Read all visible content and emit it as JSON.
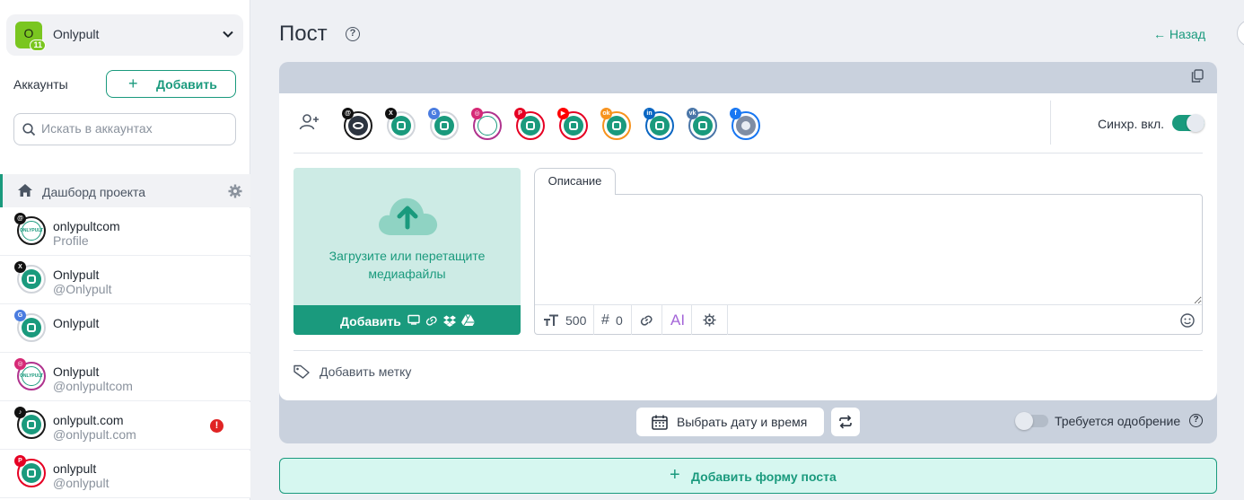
{
  "sidebar": {
    "project": {
      "avatar_letter": "O",
      "badge": "11",
      "name": "Onlypult"
    },
    "accounts_title": "Аккаунты",
    "add_button": "Добавить",
    "search_placeholder": "Искать в аккаунтах",
    "dashboard_label": "Дашборд проекта",
    "accounts": [
      {
        "name": "onlypultcom",
        "handle": "Profile",
        "network": "threads",
        "badge": "@"
      },
      {
        "name": "Onlypult",
        "handle": "@Onlypult",
        "network": "x",
        "badge": "X"
      },
      {
        "name": "Onlypult",
        "handle": "",
        "network": "google-business",
        "badge": "G"
      },
      {
        "name": "Onlypult",
        "handle": "@onlypultcom",
        "network": "instagram",
        "badge": "◎"
      },
      {
        "name": "onlypult.com",
        "handle": "@onlypult.com",
        "network": "tiktok",
        "badge": "♪",
        "warning": "!"
      },
      {
        "name": "onlypult",
        "handle": "@onlypult",
        "network": "pinterest",
        "badge": "P"
      }
    ]
  },
  "header": {
    "title": "Пост",
    "back_label": "← Назад"
  },
  "editor": {
    "networks": [
      {
        "name": "threads-icon",
        "badge": "@",
        "color": "#111111"
      },
      {
        "name": "x-icon",
        "badge": "X",
        "color": "#111111"
      },
      {
        "name": "google-business-icon",
        "badge": "G",
        "color": "#4a7ce0"
      },
      {
        "name": "instagram-icon",
        "badge": "◎",
        "color": "#d62976"
      },
      {
        "name": "pinterest-icon",
        "badge": "P",
        "color": "#e60023"
      },
      {
        "name": "youtube-icon",
        "badge": "▶",
        "color": "#ff0000"
      },
      {
        "name": "odnoklassniki-icon",
        "badge": "ok",
        "color": "#f7931e"
      },
      {
        "name": "linkedin-icon",
        "badge": "in",
        "color": "#0a66c2"
      },
      {
        "name": "vk-icon",
        "badge": "vk",
        "color": "#4a76a8"
      },
      {
        "name": "facebook-icon",
        "badge": "f",
        "color": "#1877f2"
      }
    ],
    "sync_label": "Синхр. вкл.",
    "upload": {
      "line1": "Загрузите или перетащите",
      "line2": "медиафайлы",
      "add_label": "Добавить"
    },
    "description_tab": "Описание",
    "toolbar": {
      "char_count": "500",
      "hashtag_count": "0",
      "ai_label": "AI"
    },
    "add_tag": "Добавить метку",
    "date_button": "Выбрать дату и время",
    "approval_label": "Требуется одобрение"
  },
  "footer": {
    "add_form_label": "Добавить форму поста"
  },
  "colors": {
    "accent": "#1a9a7d",
    "warning": "#e02424"
  }
}
